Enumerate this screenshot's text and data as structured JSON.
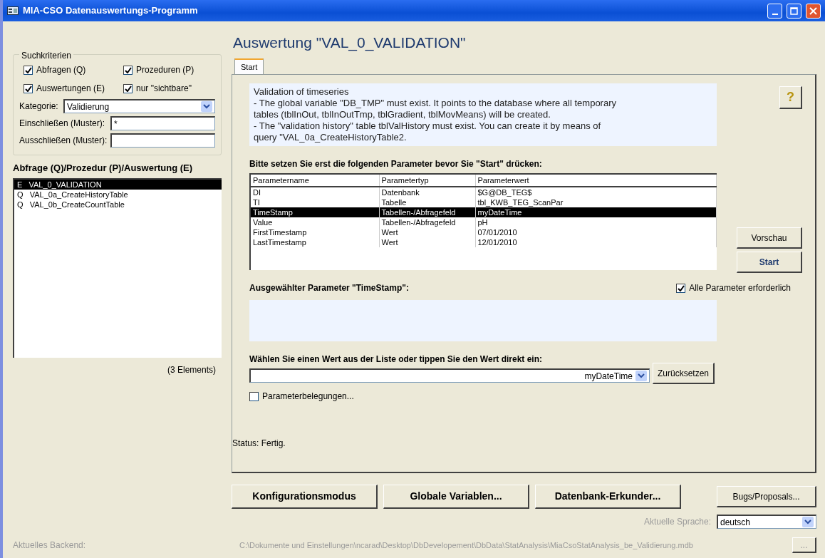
{
  "window": {
    "title": "MIA-CSO Datenauswertungs-Programm"
  },
  "search_criteria": {
    "legend": "Suchkriterien",
    "checkboxes": [
      {
        "label": "Abfragen (Q)",
        "checked": true
      },
      {
        "label": "Prozeduren (P)",
        "checked": true
      },
      {
        "label": "Auswertungen (E)",
        "checked": true
      },
      {
        "label": "nur \"sichtbare\"",
        "checked": true
      }
    ],
    "fields": [
      {
        "kind": "dropdown",
        "label": "Kategorie:",
        "value": "Validierung"
      },
      {
        "kind": "text",
        "label": "Einschließen (Muster):",
        "value": "*"
      },
      {
        "kind": "text",
        "label": "Ausschließen (Muster):"
      }
    ]
  },
  "object_list": {
    "heading": "Abfrage (Q)/Prozedur (P)/Auswertung (E)",
    "items": [
      {
        "type": "E",
        "name": "VAL_0_VALIDATION",
        "selected": true
      },
      {
        "type": "Q",
        "name": "VAL_0a_CreateHistoryTable",
        "selected": false
      },
      {
        "type": "Q",
        "name": "VAL_0b_CreateCountTable",
        "selected": false
      }
    ],
    "count": "(3 Elements)"
  },
  "evaluation": {
    "title": "Auswertung \"VAL_0_VALIDATION\"",
    "tabs": [
      {
        "label": "Start",
        "selected": true
      }
    ],
    "description": [
      "Validation of timeseries",
      "- The global variable \"DB_TMP\" must exist. It points to the database where all temporary",
      "tables (tblInOut, tblInOutTmp, tblGradient, tblMovMeans) will be created.",
      "- The \"validation history\" table tblValHistory must exist. You can create it by means of",
      "query \"VAL_0a_CreateHistoryTable2."
    ],
    "help_button": "?",
    "params_heading": "Bitte setzen Sie erst die folgenden Parameter bevor Sie \"Start\" drücken:",
    "columns": [
      "Parametername",
      "Parametertyp",
      "Parameterwert"
    ],
    "rows": [
      {
        "cells": [
          "DI",
          "Datenbank",
          "$G@DB_TEG$"
        ],
        "selected": false
      },
      {
        "cells": [
          "TI",
          "Tabelle",
          "tbl_KWB_TEG_ScanPar"
        ],
        "selected": false
      },
      {
        "cells": [
          "TimeStamp",
          "Tabellen-/Abfragefeld",
          "myDateTime"
        ],
        "selected": true
      },
      {
        "cells": [
          "Value",
          "Tabellen-/Abfragefeld",
          "pH"
        ],
        "selected": false
      },
      {
        "cells": [
          "FirstTimestamp",
          "Wert",
          "07/01/2010"
        ],
        "selected": false
      },
      {
        "cells": [
          "LastTimestamp",
          "Wert",
          "12/01/2010"
        ],
        "selected": false
      }
    ],
    "side_buttons": [
      {
        "label": "Vorschau",
        "bold": false
      },
      {
        "label": "Start",
        "bold": true
      }
    ],
    "selected_param_label": "Ausgewählter Parameter \"TimeStamp\":",
    "all_required": {
      "label": "Alle Parameter erforderlich",
      "checked": true
    },
    "value_label": "Wählen Sie einen Wert aus der Liste oder tippen Sie den Wert direkt ein:",
    "value_combo": {
      "value": "myDateTime"
    },
    "reset_button": "Zurücksetzen",
    "param_assign": {
      "label": "Parameterbelegungen...",
      "checked": false
    },
    "status": "Status: Fertig."
  },
  "buttons": [
    "Konfigurationsmodus",
    "Globale Variablen...",
    "Datenbank-Erkunder..."
  ],
  "bugs_button": "Bugs/Proposals...",
  "language": {
    "label": "Aktuelle Sprache:",
    "value": "deutsch"
  },
  "backend": {
    "label": "Aktuelles Backend:",
    "path": "C:\\Dokumente und Einstellungen\\ncarad\\Desktop\\DbDevelopement\\DbData\\StatAnalysis\\MiaCsoStatAnalysis_be_Validierung.mdb",
    "browse_button": "..."
  }
}
